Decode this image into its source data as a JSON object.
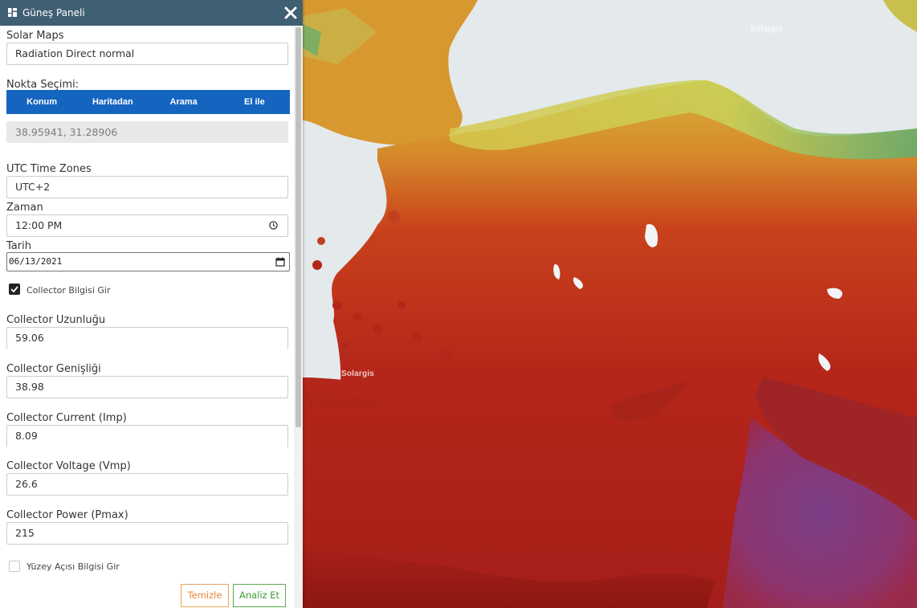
{
  "panel": {
    "title": "Güneş Paneli",
    "close_icon": "close-icon",
    "header_icon": "dashboard-icon"
  },
  "solar_maps": {
    "label": "Solar Maps",
    "value": "Radiation Direct normal"
  },
  "point_selection": {
    "label": "Nokta Seçimi:",
    "tabs": [
      "Konum",
      "Haritadan",
      "Arama",
      "El ile"
    ],
    "coordinates": "38.95941, 31.28906"
  },
  "utc": {
    "label": "UTC Time Zones",
    "value": "UTC+2"
  },
  "time": {
    "label": "Zaman",
    "value": "12:00 PM"
  },
  "date": {
    "label": "Tarih",
    "value": "06/13/2021"
  },
  "collector_checkbox": {
    "label": "Collector Bilgisi Gir",
    "checked": true
  },
  "collector_length": {
    "label": "Collector Uzunluğu",
    "value": "59.06"
  },
  "collector_width": {
    "label": "Collector Genişliği",
    "value": "38.98"
  },
  "collector_current": {
    "label": "Collector Current (Imp)",
    "value": "8.09"
  },
  "collector_voltage": {
    "label": "Collector Voltage (Vmp)",
    "value": "26.6"
  },
  "collector_power": {
    "label": "Collector Power (Pmax)",
    "value": "215"
  },
  "surface_checkbox": {
    "label": "Yüzey Açısı Bilgisi Gir",
    "checked": false
  },
  "buttons": {
    "clear": "Temizle",
    "analyze": "Analiz Et"
  },
  "map": {
    "watermark": "Solargis",
    "sea_color": "#e4e9ec",
    "high_radiation_color": "#b3231a",
    "low_radiation_color": "#e0c64a",
    "very_high_radiation_color": "#8a3a78"
  }
}
